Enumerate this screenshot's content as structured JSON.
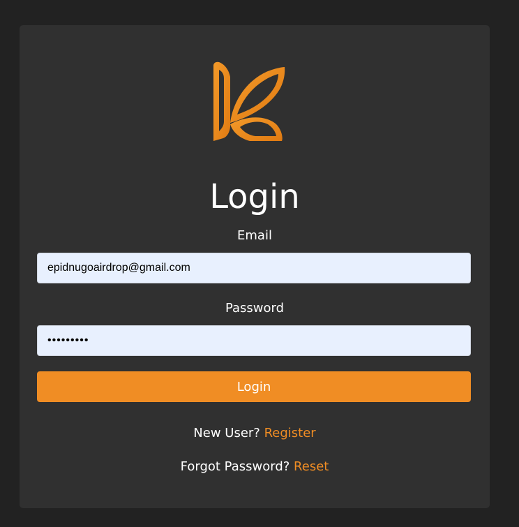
{
  "colors": {
    "background": "#222222",
    "card": "#303030",
    "accent": "#f08d24",
    "input_bg": "#e8f0fe",
    "text": "#ffffff"
  },
  "logo": {
    "icon": "k-leaf-logo-icon"
  },
  "form": {
    "title": "Login",
    "email_label": "Email",
    "email_value": "epidnugoairdrop@gmail.com",
    "password_label": "Password",
    "password_value": "•••••••••",
    "submit_label": "Login"
  },
  "footer": {
    "new_user_text": "New User? ",
    "register_link": "Register",
    "forgot_text": "Forgot Password? ",
    "reset_link": "Reset"
  }
}
